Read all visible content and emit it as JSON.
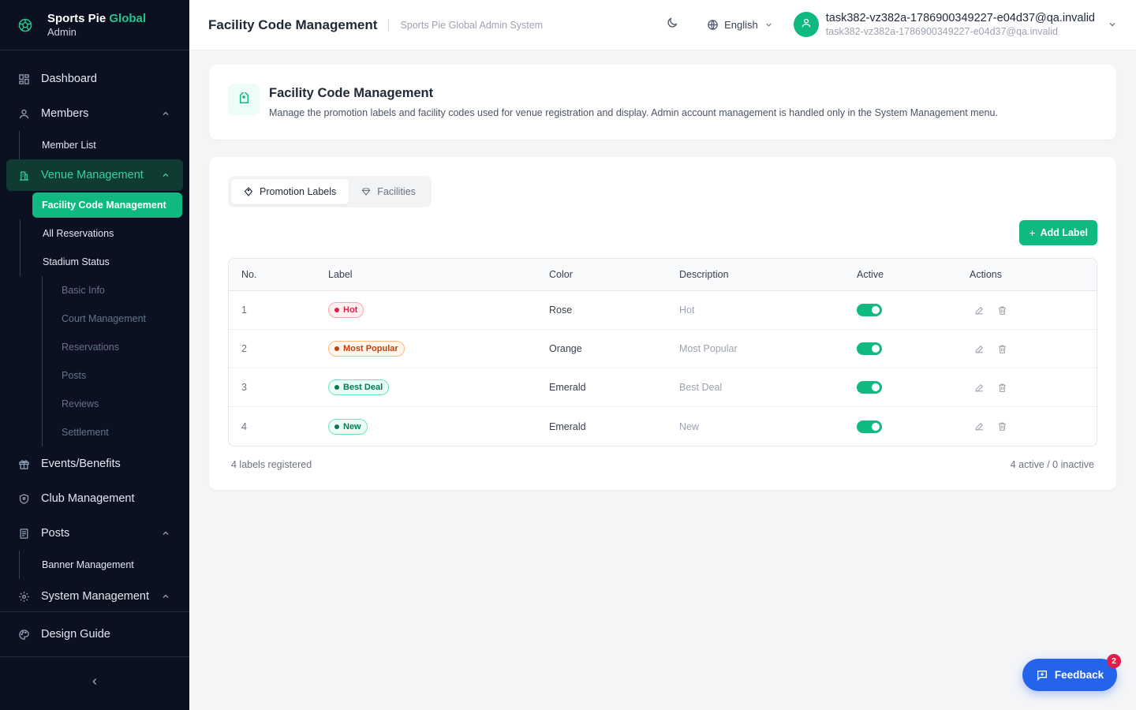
{
  "brand": {
    "name_prefix": "Sports Pie",
    "name_accent": "Global",
    "subtitle": "Admin",
    "accent_color": "#22c58b"
  },
  "sidebar": {
    "items": [
      {
        "label": "Dashboard",
        "icon": "dashboard-icon"
      },
      {
        "label": "Members",
        "icon": "user-icon",
        "expanded": true,
        "children": [
          "Member List"
        ]
      },
      {
        "label": "Venue Management",
        "icon": "building-icon",
        "expanded": true,
        "active": true,
        "children": [
          "Facility Code Management",
          "All Reservations",
          "Stadium Status"
        ],
        "stadium_children": [
          "Basic Info",
          "Court Management",
          "Reservations",
          "Posts",
          "Reviews",
          "Settlement"
        ]
      },
      {
        "label": "Events/Benefits",
        "icon": "gift-icon"
      },
      {
        "label": "Club Management",
        "icon": "shield-icon"
      },
      {
        "label": "Posts",
        "icon": "document-icon",
        "expanded": true,
        "children": [
          "Banner Management"
        ]
      },
      {
        "label": "System Management",
        "icon": "gear-icon",
        "expanded": true
      }
    ],
    "bottom": {
      "label": "Design Guide",
      "icon": "palette-icon"
    }
  },
  "header": {
    "title": "Facility Code Management",
    "subtitle": "Sports Pie Global Admin System",
    "language": "English",
    "user_name": "task382-vz382a-1786900349227-e04d37@qa.invalid",
    "user_email": "task382-vz382a-1786900349227-e04d37@qa.invalid"
  },
  "intro": {
    "title": "Facility Code Management",
    "description": "Manage the promotion labels and facility codes used for venue registration and display. Admin account management is handled only in the System Management menu."
  },
  "tabs": [
    {
      "label": "Promotion Labels",
      "active": true,
      "icon": "tag-icon"
    },
    {
      "label": "Facilities",
      "active": false,
      "icon": "gem-icon"
    }
  ],
  "toolbar": {
    "add_label": "Add Label"
  },
  "table": {
    "headers": [
      "No.",
      "Label",
      "Color",
      "Description",
      "Active",
      "Actions"
    ],
    "rows": [
      {
        "no": "1",
        "label": "Hot",
        "color": "Rose",
        "description": "Hot",
        "active": true,
        "badge_fg": "#e11d48",
        "badge_bg": "#fff1f2",
        "badge_border": "#fda4af"
      },
      {
        "no": "2",
        "label": "Most Popular",
        "color": "Orange",
        "description": "Most Popular",
        "active": true,
        "badge_fg": "#c2410c",
        "badge_bg": "#fff7ed",
        "badge_border": "#fdba74"
      },
      {
        "no": "3",
        "label": "Best Deal",
        "color": "Emerald",
        "description": "Best Deal",
        "active": true,
        "badge_fg": "#047857",
        "badge_bg": "#ecfdf5",
        "badge_border": "#6ee7b7"
      },
      {
        "no": "4",
        "label": "New",
        "color": "Emerald",
        "description": "New",
        "active": true,
        "badge_fg": "#047857",
        "badge_bg": "#ecfdf5",
        "badge_border": "#6ee7b7"
      }
    ]
  },
  "footer": {
    "count_text": "4 labels registered",
    "status_text": "4 active / 0 inactive"
  },
  "feedback": {
    "label": "Feedback",
    "badge": "2"
  }
}
